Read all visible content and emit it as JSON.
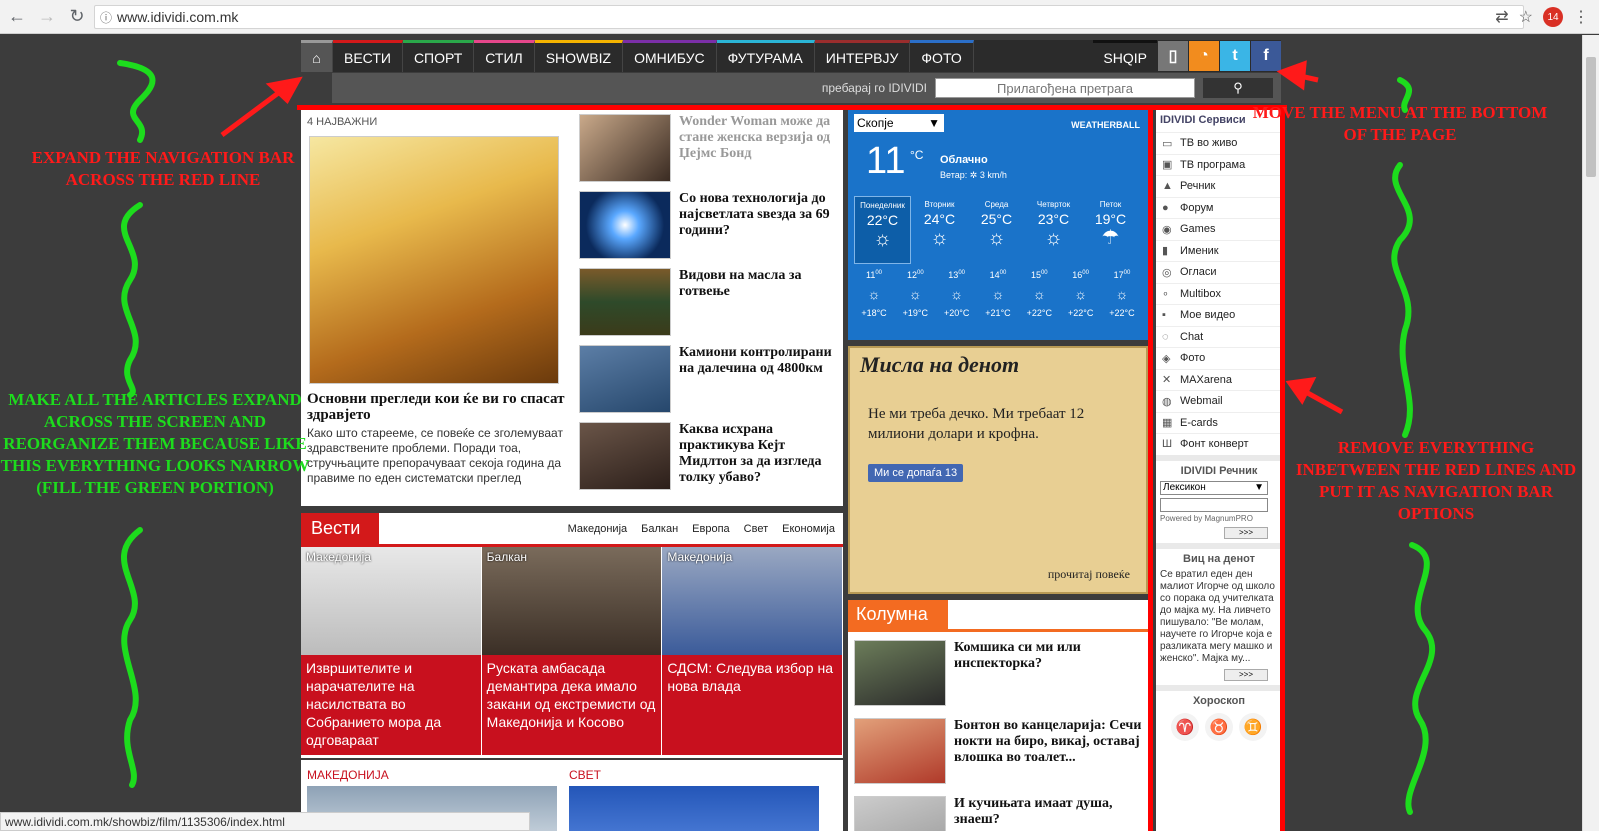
{
  "browser": {
    "url": "www.idividi.com.mk",
    "extension_badge": "14"
  },
  "menu": {
    "items": [
      {
        "label": "ВЕСТИ",
        "color": "#d3191a"
      },
      {
        "label": "СПОРТ",
        "color": "#2aa84a"
      },
      {
        "label": "СТИЛ",
        "color": "#e6478b"
      },
      {
        "label": "SHOWBIZ",
        "color": "#f5b400"
      },
      {
        "label": "ОМНИБУС",
        "color": "#7b2fa8"
      },
      {
        "label": "ФУТУРАМА",
        "color": "#2bb5d6"
      },
      {
        "label": "ИНТЕРВЈУ",
        "color": "#9a2d2d"
      },
      {
        "label": "ФОТО",
        "color": "#2b6fc9"
      }
    ],
    "shqip": "SHQIP"
  },
  "search": {
    "label": "пребарај го IDIVIDI",
    "placeholder": "Прилагођена претрага"
  },
  "top_news": {
    "section_label": "4 НАЈВАЖНИ",
    "main_title": "Основни прегледи кои ќе ви го спасат здравјето",
    "main_text": "Како што стареeме, се повеќе се зголемуваат здравствените проблеми. Поради тоа, стручњаците препорачуваат секоја година да правиме по еден систематски преглед",
    "side": [
      {
        "title": "Wonder Woman може да стане женска верзија од Џејмс Бонд",
        "muted": true
      },
      {
        "title": "Со нова технологија до најсветлата ѕвезда за 69 години?",
        "muted": false
      },
      {
        "title": "Видови на масла за готвење",
        "muted": false
      },
      {
        "title": "Камиони контролирани на далечина од 4800км",
        "muted": false
      },
      {
        "title": "Каква исхрана практикува Кејт Мидлтон за да изгледа толку убаво?",
        "muted": false
      }
    ]
  },
  "vesti": {
    "title": "Вести",
    "links": [
      "Македонија",
      "Балкан",
      "Европа",
      "Свет",
      "Економија"
    ],
    "cards": [
      {
        "category": "Македонија",
        "title": "Извршителите и нарачателите на насилствата во Собранието мора да одговараат"
      },
      {
        "category": "Балкан",
        "title": "Руската амбасада демантира дека имало закани од екстремисти од Македонија и Косово"
      },
      {
        "category": "Македонија",
        "title": "СДСМ: Следува избор на нова влада"
      }
    ],
    "bottom_labels": [
      "МАКЕДОНИЈА",
      "СВЕТ"
    ]
  },
  "weather": {
    "city": "Скопје",
    "brand": "WEATHERBALL",
    "temp": "11",
    "unit": "°C",
    "condition": "Облачно",
    "wind_label": "Ветар:",
    "wind_value": "3 km/h",
    "days": [
      {
        "name": "Понеделник",
        "temp": "22°C",
        "icon": "cloud-sun"
      },
      {
        "name": "Вторник",
        "temp": "24°C",
        "icon": "cloud-sun"
      },
      {
        "name": "Среда",
        "temp": "25°C",
        "icon": "cloud-sun"
      },
      {
        "name": "Четврток",
        "temp": "23°C",
        "icon": "cloud-sun"
      },
      {
        "name": "Петок",
        "temp": "19°C",
        "icon": "cloud-rain"
      }
    ],
    "hours": [
      {
        "h": "11",
        "t": "+18°C"
      },
      {
        "h": "12",
        "t": "+19°C"
      },
      {
        "h": "13",
        "t": "+20°C"
      },
      {
        "h": "14",
        "t": "+21°C"
      },
      {
        "h": "15",
        "t": "+22°C"
      },
      {
        "h": "16",
        "t": "+22°C"
      },
      {
        "h": "17",
        "t": "+22°C"
      }
    ]
  },
  "misla": {
    "title": "Мисла на денот",
    "text": "Не ми треба дечко. Ми требаат 12 милиони долари и крофна.",
    "like": "Ми се допаѓа 13",
    "more": "прочитај повеќе"
  },
  "kolumna": {
    "title": "Колумна",
    "items": [
      "Комшика си ми или инспекторка?",
      "Бонтон во канцеларија: Сечи нокти на биро, викај, оставај влошка во тоалет...",
      "И кучињата имаат душа, знаеш?"
    ]
  },
  "services": {
    "title": "IDIVIDI Сервиси",
    "items": [
      {
        "label": "ТВ во живо",
        "icon": "tv-icon"
      },
      {
        "label": "ТВ програма",
        "icon": "tv-guide-icon"
      },
      {
        "label": "Речник",
        "icon": "dictionary-icon"
      },
      {
        "label": "Форум",
        "icon": "forum-icon"
      },
      {
        "label": "Games",
        "icon": "games-icon"
      },
      {
        "label": "Именик",
        "icon": "phonebook-icon"
      },
      {
        "label": "Огласи",
        "icon": "ads-icon"
      },
      {
        "label": "Multibox",
        "icon": "multibox-icon"
      },
      {
        "label": "Мое видео",
        "icon": "video-icon"
      },
      {
        "label": "Chat",
        "icon": "chat-icon"
      },
      {
        "label": "Фото",
        "icon": "photo-icon"
      },
      {
        "label": "MAXarena",
        "icon": "maxarena-icon"
      },
      {
        "label": "Webmail",
        "icon": "webmail-icon"
      },
      {
        "label": "E-cards",
        "icon": "ecards-icon"
      },
      {
        "label": "Фонт конверт",
        "icon": "font-icon"
      }
    ],
    "dict_title": "IDIVIDI Речник",
    "dict_select": "Лексикон",
    "dict_powered": "Powered by MagnumPRO",
    "more_label": ">>>",
    "joke_title": "Виц на денот",
    "joke_text": "Се вратил еден ден малиот Игорче од школо со порака од учителката до мајка му. На ливчето пишувало: \"Ве молам, научете го Игорче која е разликата мегу машко и женско\". Мајка му...",
    "horoscope_title": "Хороскоп"
  },
  "status_url": "www.idividi.com.mk/showbiz/film/1135306/index.html",
  "annotations": {
    "expand_nav": "EXPAND THE NAVIGATION BAR ACROSS THE RED LINE",
    "move_menu": "MOVE THE MENU AT THE BOTTOM OF THE PAGE",
    "make_expand": "MAKE ALL THE ARTICLES EXPAND ACROSS THE SCREEN AND REORGANIZE THEM BECAUSE LIKE THIS EVERYTHING LOOKS NARROW (FILL THE GREEN PORTION)",
    "remove_between": "REMOVE EVERYTHING INBETWEEN THE RED LINES AND PUT IT AS NAVIGATION BAR OPTIONS",
    "question_mark": "?"
  }
}
